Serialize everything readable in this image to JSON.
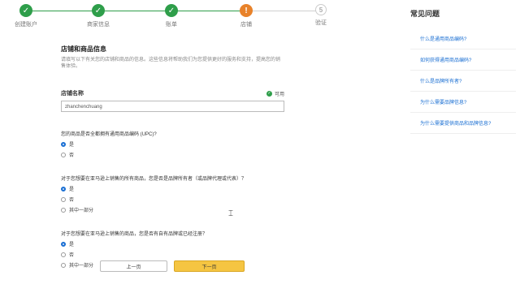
{
  "stepper": {
    "steps": [
      {
        "label": "创建账户",
        "state": "done"
      },
      {
        "label": "商家信息",
        "state": "done"
      },
      {
        "label": "账单",
        "state": "done"
      },
      {
        "label": "店铺",
        "state": "current",
        "icon": "!"
      },
      {
        "label": "验证",
        "state": "todo",
        "icon": "5"
      }
    ]
  },
  "main": {
    "section_title": "店铺和商品信息",
    "description": "请填写以下有关您的店铺和商品的信息。这些信息将帮助我们为您提供更好的服务和支持，提高您的销售体验。",
    "store_name_label": "店铺名称",
    "verify_label": "可用",
    "store_name_value": "zhanchenchuang",
    "q1": "您的商品是否全都拥有通用商品编码 (UPC)?",
    "q1_options": [
      "是",
      "否"
    ],
    "q2": "对于您想要在亚马逊上销售的所有商品，您是否是品牌所有者（或品牌代理或代表）？",
    "q2_options": [
      "是",
      "否",
      "其中一部分"
    ],
    "q3": "对于您想要在亚马逊上销售的商品，您是否有自有品牌或已经注册？",
    "q3_options": [
      "是",
      "否",
      "其中一部分"
    ]
  },
  "faq": {
    "title": "常见问题",
    "items": [
      "什么是通用商品编码?",
      "如何获得通用商品编码?",
      "什么是品牌所有者?",
      "为什么需要品牌信息?",
      "为什么需要提供商品和品牌信息?"
    ]
  },
  "buttons": {
    "prev": "上一页",
    "next": "下一页"
  },
  "colors": {
    "done": "#2e9e4a",
    "current": "#e8822a",
    "primary": "#f5c542",
    "link": "#1a6fd3"
  }
}
